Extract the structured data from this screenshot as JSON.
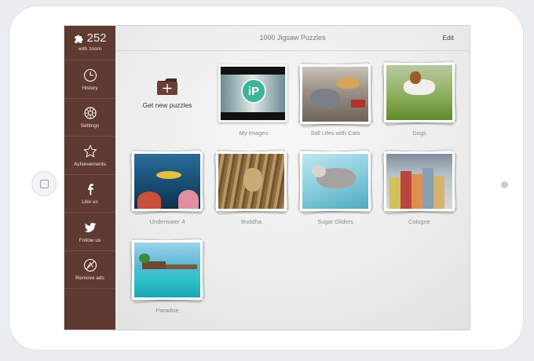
{
  "sidebar": {
    "score": "252",
    "score_sub": "with zoom",
    "items": [
      {
        "label": "History",
        "icon": "clock-icon"
      },
      {
        "label": "Settings",
        "icon": "gear-icon"
      },
      {
        "label": "Achievements",
        "icon": "star-icon"
      },
      {
        "label": "Like us",
        "icon": "facebook-icon"
      },
      {
        "label": "Follow us",
        "icon": "twitter-icon"
      },
      {
        "label": "Remove ads",
        "icon": "no-ads-icon"
      }
    ]
  },
  "header": {
    "title": "1000 Jigsaw Puzzles",
    "edit_label": "Edit"
  },
  "get_new": {
    "label": "Get new puzzles"
  },
  "tiles": [
    {
      "label": "My Images"
    },
    {
      "label": "Still Lifes with Cats"
    },
    {
      "label": "Dogs"
    },
    {
      "label": "Underwater 4"
    },
    {
      "label": "Buddha"
    },
    {
      "label": "Sugar Gliders"
    },
    {
      "label": "Cologne"
    },
    {
      "label": "Paradise"
    }
  ],
  "colors": {
    "sidebar": "#5e3a30",
    "accent": "#4fb8a0"
  }
}
